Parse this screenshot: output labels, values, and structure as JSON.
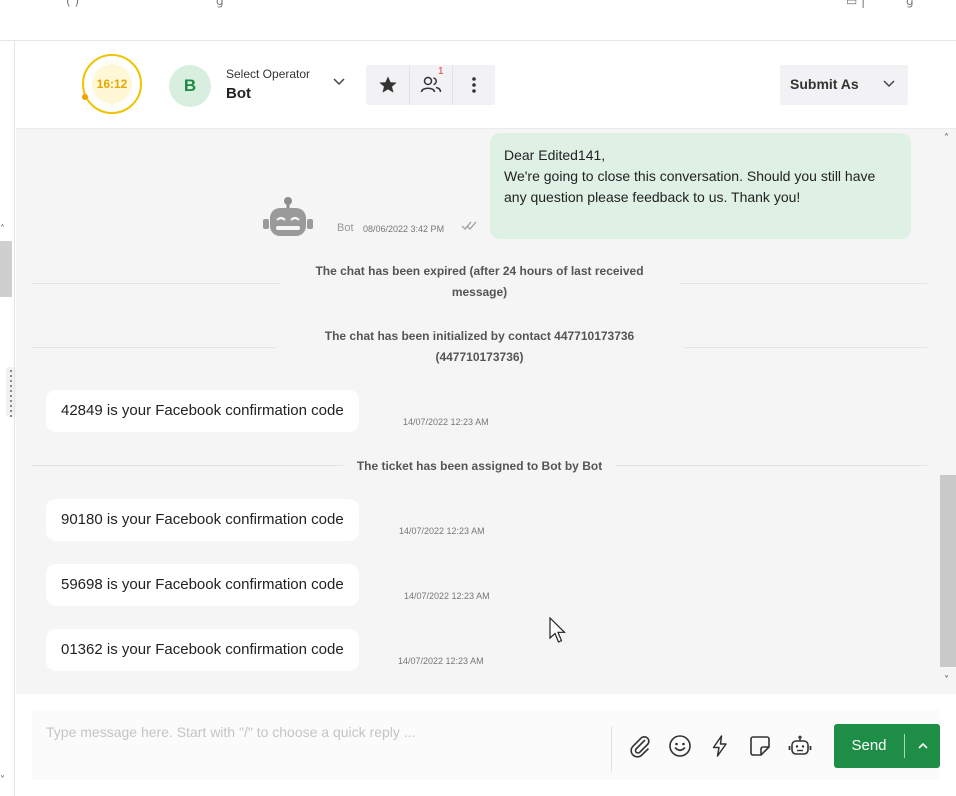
{
  "header": {
    "timer": "16:12",
    "operator_initial": "B",
    "operator_label": "Select Operator",
    "operator_name": "Bot",
    "participants_badge": "1",
    "submit_as_label": "Submit As"
  },
  "messages": {
    "outgoing_text": "Dear Edited141,\nWe're going to close this conversation. Should you still have any question please feedback to us. Thank you!",
    "outgoing_sender": "Bot",
    "outgoing_time": "08/06/2022 3:42 PM",
    "system_1": "The chat has been expired (after 24 hours of last received message)",
    "system_2": "The chat has been initialized by contact 447710173736 (447710173736)",
    "incoming_1_text": "42849 is your Facebook confirmation code",
    "incoming_1_time": "14/07/2022 12:23 AM",
    "system_3": "The ticket has been assigned to Bot by Bot",
    "incoming_2_text": "90180 is your Facebook confirmation code",
    "incoming_2_time": "14/07/2022 12:23 AM",
    "incoming_3_text": "59698 is your Facebook confirmation code",
    "incoming_3_time": "14/07/2022 12:23 AM",
    "incoming_4_text": "01362 is your Facebook confirmation code",
    "incoming_4_time": "14/07/2022 12:23 AM"
  },
  "composer": {
    "placeholder": "Type message here. Start with \"/\" to choose a quick reply ...",
    "send_label": "Send"
  },
  "colors": {
    "accent_green": "#1e8e46",
    "outgoing_bubble": "#dff0e4",
    "timer_ring": "#f2c200",
    "badge_red": "#e53935"
  },
  "icons": [
    "star-icon",
    "users-icon",
    "more-vertical-icon",
    "chevron-down-icon",
    "paperclip-icon",
    "smiley-icon",
    "lightning-icon",
    "sticker-icon",
    "robot-icon",
    "chevron-up-icon",
    "double-check-icon"
  ]
}
